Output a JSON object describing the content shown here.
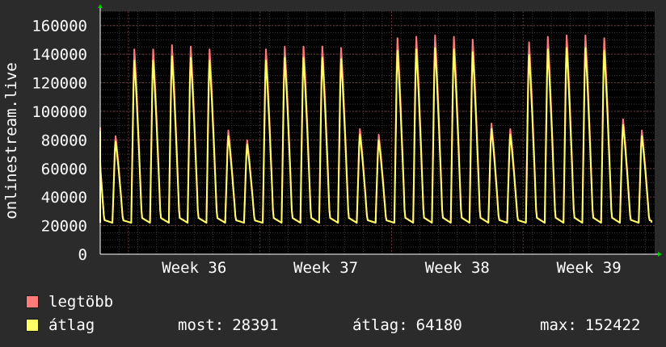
{
  "chart_data": {
    "type": "line",
    "ylabel": "onlinestream.live",
    "ylim": [
      0,
      170000
    ],
    "yticks": [
      0,
      20000,
      40000,
      60000,
      80000,
      100000,
      120000,
      140000,
      160000
    ],
    "ytick_labels": [
      "0",
      "20000",
      "40000",
      "60000",
      "80000",
      "100000",
      "120000",
      "140000",
      "160000"
    ],
    "xtick_labels": [
      "Week 36",
      "Week 37",
      "Week 38",
      "Week 39"
    ],
    "daily_peaks": {
      "series_max": [
        90000,
        84000,
        146000,
        146000,
        149000,
        148000,
        146000,
        88000,
        81000,
        146000,
        148000,
        148000,
        148000,
        147000,
        89000,
        85000,
        154000,
        155000,
        156000,
        155000,
        153000,
        93000,
        89000,
        151000,
        155000,
        156000,
        156000,
        154000,
        96000,
        88000
      ],
      "series_avg": [
        87000,
        80000,
        138000,
        138000,
        141000,
        140000,
        138000,
        84000,
        78000,
        138000,
        140000,
        140000,
        140000,
        139000,
        85000,
        81000,
        145000,
        146000,
        147000,
        146000,
        144000,
        89000,
        85000,
        142000,
        146000,
        147000,
        147000,
        145000,
        92000,
        84000
      ],
      "trough": 22000
    },
    "series": [
      {
        "name": "legtöbb",
        "color": "#ff7a7a"
      },
      {
        "name": "átlag",
        "color": "#ffff66"
      }
    ],
    "grid": true
  },
  "legend": {
    "max_label": "legtöbb",
    "avg_label": "átlag",
    "max_color": "#ff7a7a",
    "avg_color": "#ffff66"
  },
  "stats": {
    "current_label": "most:",
    "current_value": "28391",
    "average_label": "átlag:",
    "average_value": "64180",
    "max_label": "max:",
    "max_value": "152422"
  }
}
